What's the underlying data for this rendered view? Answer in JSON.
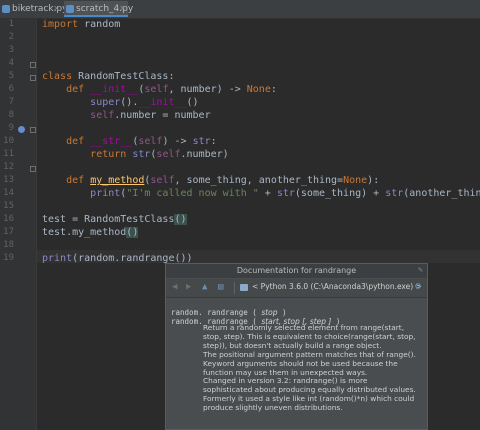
{
  "tabs": [
    {
      "label": "biketrack.py",
      "active": false
    },
    {
      "label": "scratch_4.py",
      "active": true
    }
  ],
  "line_numbers": [
    "1",
    "2",
    "3",
    "4",
    "5",
    "6",
    "7",
    "8",
    "9",
    "10",
    "11",
    "12",
    "13",
    "14",
    "15",
    "16",
    "17",
    "18",
    "19"
  ],
  "code": {
    "l1_import": "import",
    "l1_module": " random",
    "l5_class": "class",
    "l5_name": " RandomTestClass:",
    "l6_def": "def",
    "l6_init": "__init__",
    "l6_self": "self",
    "l6_rest": ", number) -> ",
    "l6_none": "None",
    "l6_colon": ":",
    "l7_super": "super",
    "l7_mid": "().",
    "l7_init": "__init__",
    "l7_end": "()",
    "l8_self": "self",
    "l8_rest": ".number = number",
    "l10_def": "def",
    "l10_str": "__str__",
    "l10_self": "self",
    "l10_rest": ") -> ",
    "l10_type": "str",
    "l10_colon": ":",
    "l11_return": "return",
    "l11_str": "str",
    "l11_self": "self",
    "l11_rest": ".number)",
    "l13_def": "def",
    "l13_name": "my_method",
    "l13_self": "self",
    "l13_rest": ", some_thing, another_thing=",
    "l13_none": "None",
    "l13_end": "):",
    "l14_print": "print",
    "l14_lit": "\"I'm called now with \"",
    "l14_plus1": " + ",
    "l14_str1": "str",
    "l14_arg1": "(some_thing) + ",
    "l14_str2": "str",
    "l14_arg2": "(another_thing))",
    "l17_a": "test = RandomTestClass",
    "l17_paren": "()",
    "l18_a": "test.my_method",
    "l18_paren": "()",
    "l19_print": "print",
    "l19_rest": "(random.randrange())"
  },
  "doc_popup": {
    "title": "Documentation for randrange",
    "pin_icon": "pin-icon",
    "nav_label": "< Python 3.6.0 (C:\\Anaconda3\\python.exe) >",
    "sig1_prefix": "random. randrange ( ",
    "sig1_params": "stop",
    "sig1_suffix": " )",
    "sig2_prefix": "random. randrange ( ",
    "sig2_params": "start, stop [, step ]",
    "sig2_suffix": " )",
    "para1": "Return a randomly selected element from range(start, stop, step). This is equivalent to choice(range(start, stop, step)), but doesn't actually build a range object.",
    "para2": "The positional argument pattern matches that of range(). Keyword arguments should not be used because the function may use them in unexpected ways.",
    "para3": "Changed in version 3.2: randrange() is more sophisticated about producing equally distributed values. Formerly it used a style like int (random()*n) which could produce slightly uneven distributions."
  }
}
